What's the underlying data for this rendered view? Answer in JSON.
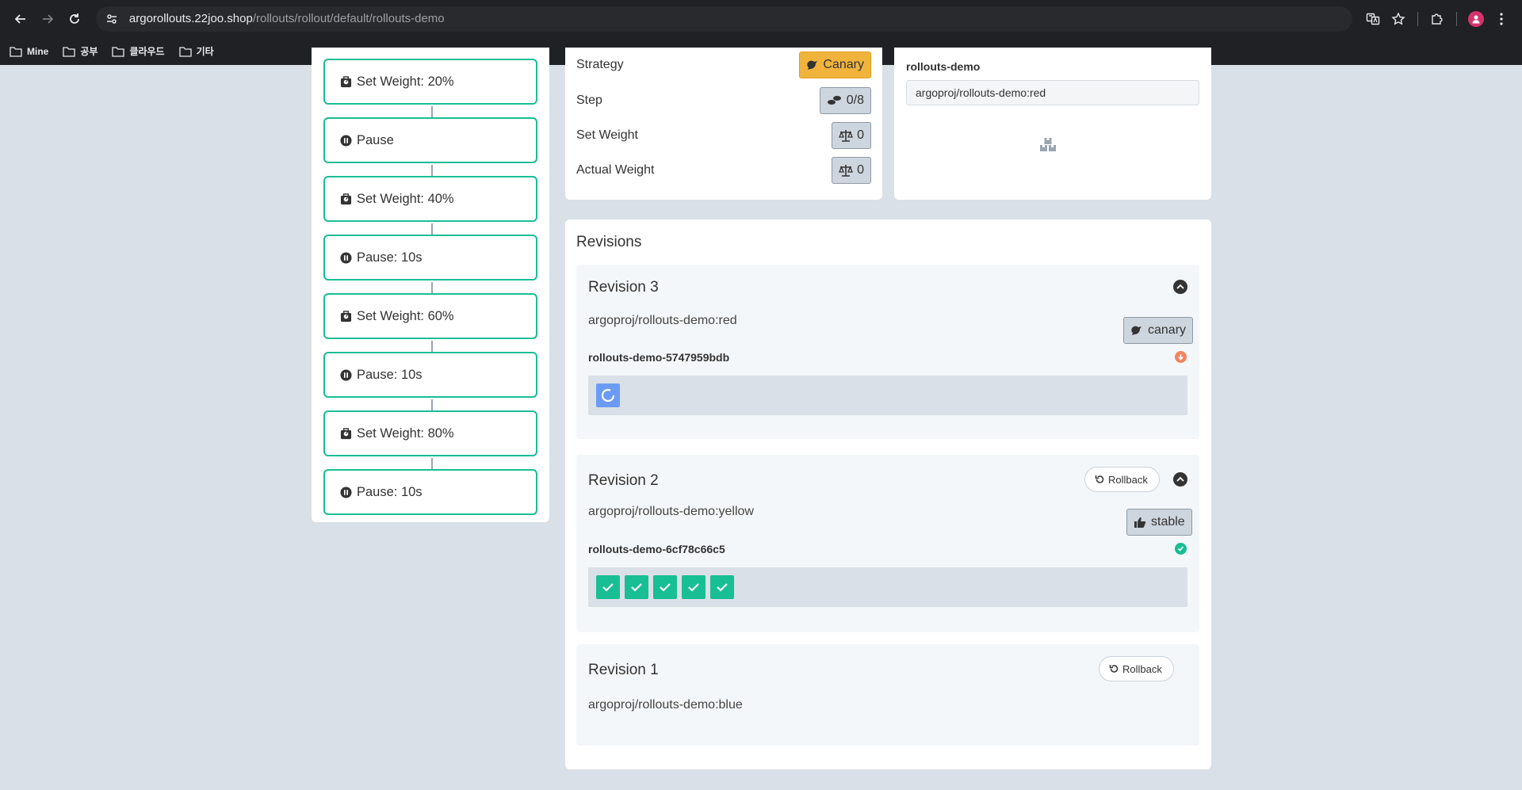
{
  "browser": {
    "url_host": "argorollouts.22joo.shop",
    "url_path": "/rollouts/rollout/default/rollouts-demo",
    "bookmarks": [
      "Mine",
      "공부",
      "클라우드",
      "기타"
    ]
  },
  "steps": [
    {
      "label": "Set Weight: 20%",
      "icon": "weight-icon"
    },
    {
      "label": "Pause",
      "icon": "pause-icon"
    },
    {
      "label": "Set Weight: 40%",
      "icon": "weight-icon"
    },
    {
      "label": "Pause: 10s",
      "icon": "pause-icon"
    },
    {
      "label": "Set Weight: 60%",
      "icon": "weight-icon"
    },
    {
      "label": "Pause: 10s",
      "icon": "pause-icon"
    },
    {
      "label": "Set Weight: 80%",
      "icon": "weight-icon"
    },
    {
      "label": "Pause: 10s",
      "icon": "pause-icon"
    }
  ],
  "summary": {
    "strategy_label": "Strategy",
    "strategy_value": "Canary",
    "step_label": "Step",
    "step_value": "0/8",
    "set_weight_label": "Set Weight",
    "set_weight_value": "0",
    "actual_weight_label": "Actual Weight",
    "actual_weight_value": "0"
  },
  "containers": {
    "name": "rollouts-demo",
    "image": "argoproj/rollouts-demo:red"
  },
  "revisions": {
    "title": "Revisions",
    "rollback_label": "Rollback",
    "items": [
      {
        "title": "Revision 3",
        "image": "argoproj/rollouts-demo:red",
        "tag": "canary",
        "replicaset": "rollouts-demo-5747959bdb",
        "status": "progressing",
        "pods_ok": 0,
        "pods_pending": 1
      },
      {
        "title": "Revision 2",
        "image": "argoproj/rollouts-demo:yellow",
        "tag": "stable",
        "replicaset": "rollouts-demo-6cf78c66c5",
        "status": "healthy",
        "pods_ok": 5,
        "pods_pending": 0
      },
      {
        "title": "Revision 1",
        "image": "argoproj/rollouts-demo:blue"
      }
    ]
  },
  "colors": {
    "accent_green": "#18be94",
    "canary_orange": "#f0b33c",
    "pending_blue": "#6b9bf5",
    "degraded_orange": "#f4845f"
  }
}
